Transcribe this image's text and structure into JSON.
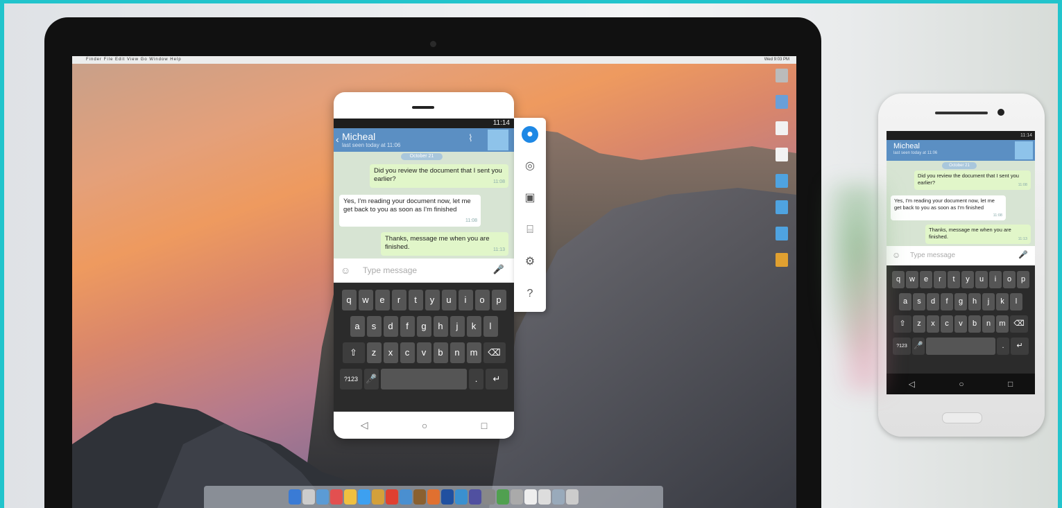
{
  "mac": {
    "menu_apple": "",
    "menus": "Finder  File  Edit  View  Go  Window  Help",
    "status": "Wed 9:03 PM"
  },
  "chat": {
    "contact_name": "Micheal",
    "last_seen": "last seen today at 11:06",
    "date_pill": "October 21",
    "status_time": "11:14",
    "messages": [
      {
        "text": "Did you review the document that I sent you earlier?",
        "time": "11:08",
        "direction": "out"
      },
      {
        "text": "Yes, I'm reading your document now, let me get back to you as soon as I'm finished",
        "time": "11:08",
        "direction": "in"
      },
      {
        "text": "Thanks, message me when you are finished.",
        "time": "11:13",
        "direction": "out"
      }
    ],
    "input_placeholder": "Type message"
  },
  "keyboard": {
    "row1": [
      "q",
      "w",
      "e",
      "r",
      "t",
      "y",
      "u",
      "i",
      "o",
      "p"
    ],
    "row2": [
      "a",
      "s",
      "d",
      "f",
      "g",
      "h",
      "j",
      "k",
      "l"
    ],
    "row3": [
      "⇧",
      "z",
      "x",
      "c",
      "v",
      "b",
      "n",
      "m",
      "⌫"
    ],
    "numbers_key": "?123",
    "period_key": ".",
    "enter_key": "↵"
  },
  "navbar": {
    "back": "◁",
    "home": "○",
    "recents": "□"
  },
  "toolbar_icons": [
    "user-icon",
    "screenshot-icon",
    "record-icon",
    "gift-icon",
    "settings-icon",
    "help-icon"
  ],
  "colors": {
    "header": "#5b8fc3",
    "accent": "#1e88e5",
    "chat_bg": "#d7e4d3",
    "out_bubble": "#e1f6c9"
  }
}
